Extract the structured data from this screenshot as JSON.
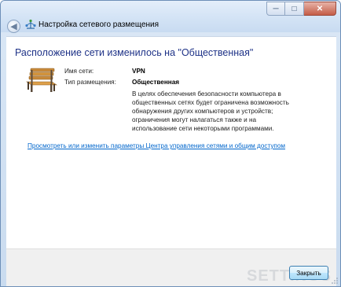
{
  "window": {
    "title": "Настройка сетевого размещения",
    "back_glyph": "◀",
    "minimize_glyph": "─",
    "maximize_glyph": "□",
    "close_glyph": "✕"
  },
  "main": {
    "heading": "Расположение сети изменилось на \"Общественная\"",
    "network_name_label": "Имя сети:",
    "network_name_value": "VPN",
    "location_type_label": "Тип размещения:",
    "location_type_value": "Общественная",
    "description_lines": [
      "В целях обеспечения безопасности компьютера в",
      "общественных сетях будет ограничена возможность",
      "обнаружения других компьютеров и устройств;",
      "ограничения могут налагаться также и на",
      "использование сети некоторыми программами."
    ],
    "link_text": "Просмотреть или изменить параметры Центра управления сетями и общим доступом"
  },
  "footer": {
    "close_label": "Закрыть",
    "watermark": "SETTINGS"
  },
  "colors": {
    "heading": "#1e3287",
    "link": "#0066cc",
    "frame": "#c9dbef"
  },
  "icons": {
    "back": "back-arrow-icon",
    "network": "network-icon",
    "location": "park-bench-icon"
  }
}
